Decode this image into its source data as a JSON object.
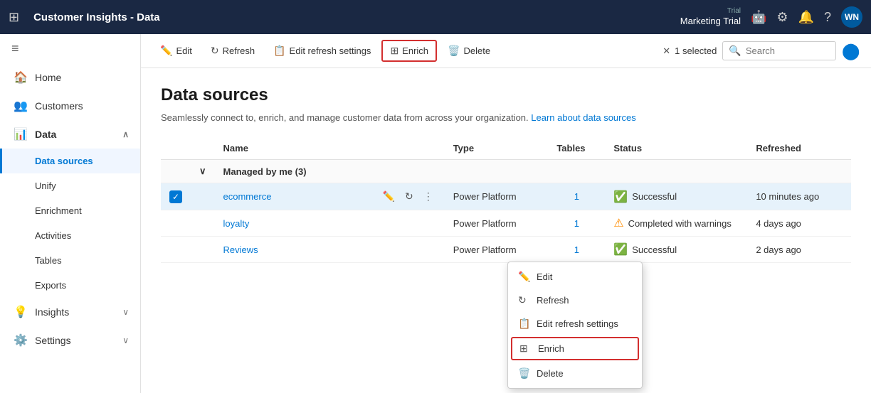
{
  "app": {
    "title": "Customer Insights - Data",
    "trial_label": "Trial",
    "trial_name": "Marketing Trial",
    "avatar": "WN"
  },
  "toolbar": {
    "edit_label": "Edit",
    "refresh_label": "Refresh",
    "edit_refresh_label": "Edit refresh settings",
    "enrich_label": "Enrich",
    "delete_label": "Delete",
    "selected_text": "1 selected",
    "search_placeholder": "Search"
  },
  "sidebar": {
    "collapse_icon": "≡",
    "items": [
      {
        "id": "home",
        "label": "Home",
        "icon": "🏠"
      },
      {
        "id": "customers",
        "label": "Customers",
        "icon": "👥"
      },
      {
        "id": "data",
        "label": "Data",
        "icon": "📊",
        "expandable": true,
        "expanded": true
      },
      {
        "id": "data-sources",
        "label": "Data sources",
        "sub": true,
        "active": true
      },
      {
        "id": "unify",
        "label": "Unify",
        "sub": true
      },
      {
        "id": "enrichment",
        "label": "Enrichment",
        "sub": true
      },
      {
        "id": "activities",
        "label": "Activities",
        "sub": true
      },
      {
        "id": "tables",
        "label": "Tables",
        "sub": true
      },
      {
        "id": "exports",
        "label": "Exports",
        "sub": true
      },
      {
        "id": "insights",
        "label": "Insights",
        "icon": "💡",
        "expandable": true
      },
      {
        "id": "settings",
        "label": "Settings",
        "icon": "⚙️",
        "expandable": true
      }
    ]
  },
  "page": {
    "title": "Data sources",
    "description": "Seamlessly connect to, enrich, and manage customer data from across your organization.",
    "learn_link": "Learn about data sources"
  },
  "table": {
    "columns": {
      "name": "Name",
      "type": "Type",
      "tables": "Tables",
      "status": "Status",
      "refreshed": "Refreshed"
    },
    "group": {
      "label": "Managed by me (3)"
    },
    "rows": [
      {
        "id": "ecommerce",
        "name": "ecommerce",
        "type": "Power Platform",
        "tables": "1",
        "status": "Successful",
        "status_type": "success",
        "refreshed": "10 minutes ago",
        "selected": true
      },
      {
        "id": "loyalty",
        "name": "loyalty",
        "type": "Power Platform",
        "tables": "1",
        "status": "Completed with warnings",
        "status_type": "warning",
        "refreshed": "4 days ago",
        "selected": false
      },
      {
        "id": "reviews",
        "name": "Reviews",
        "type": "Power Platform",
        "tables": "1",
        "status": "Successful",
        "status_type": "success",
        "refreshed": "2 days ago",
        "selected": false
      }
    ]
  },
  "context_menu": {
    "items": [
      {
        "id": "edit",
        "label": "Edit",
        "icon": "✏️"
      },
      {
        "id": "refresh",
        "label": "Refresh",
        "icon": "↻"
      },
      {
        "id": "edit-refresh-settings",
        "label": "Edit refresh settings",
        "icon": "📋"
      },
      {
        "id": "enrich",
        "label": "Enrich",
        "icon": "⊞",
        "highlighted": true
      },
      {
        "id": "delete",
        "label": "Delete",
        "icon": "🗑️"
      }
    ]
  }
}
